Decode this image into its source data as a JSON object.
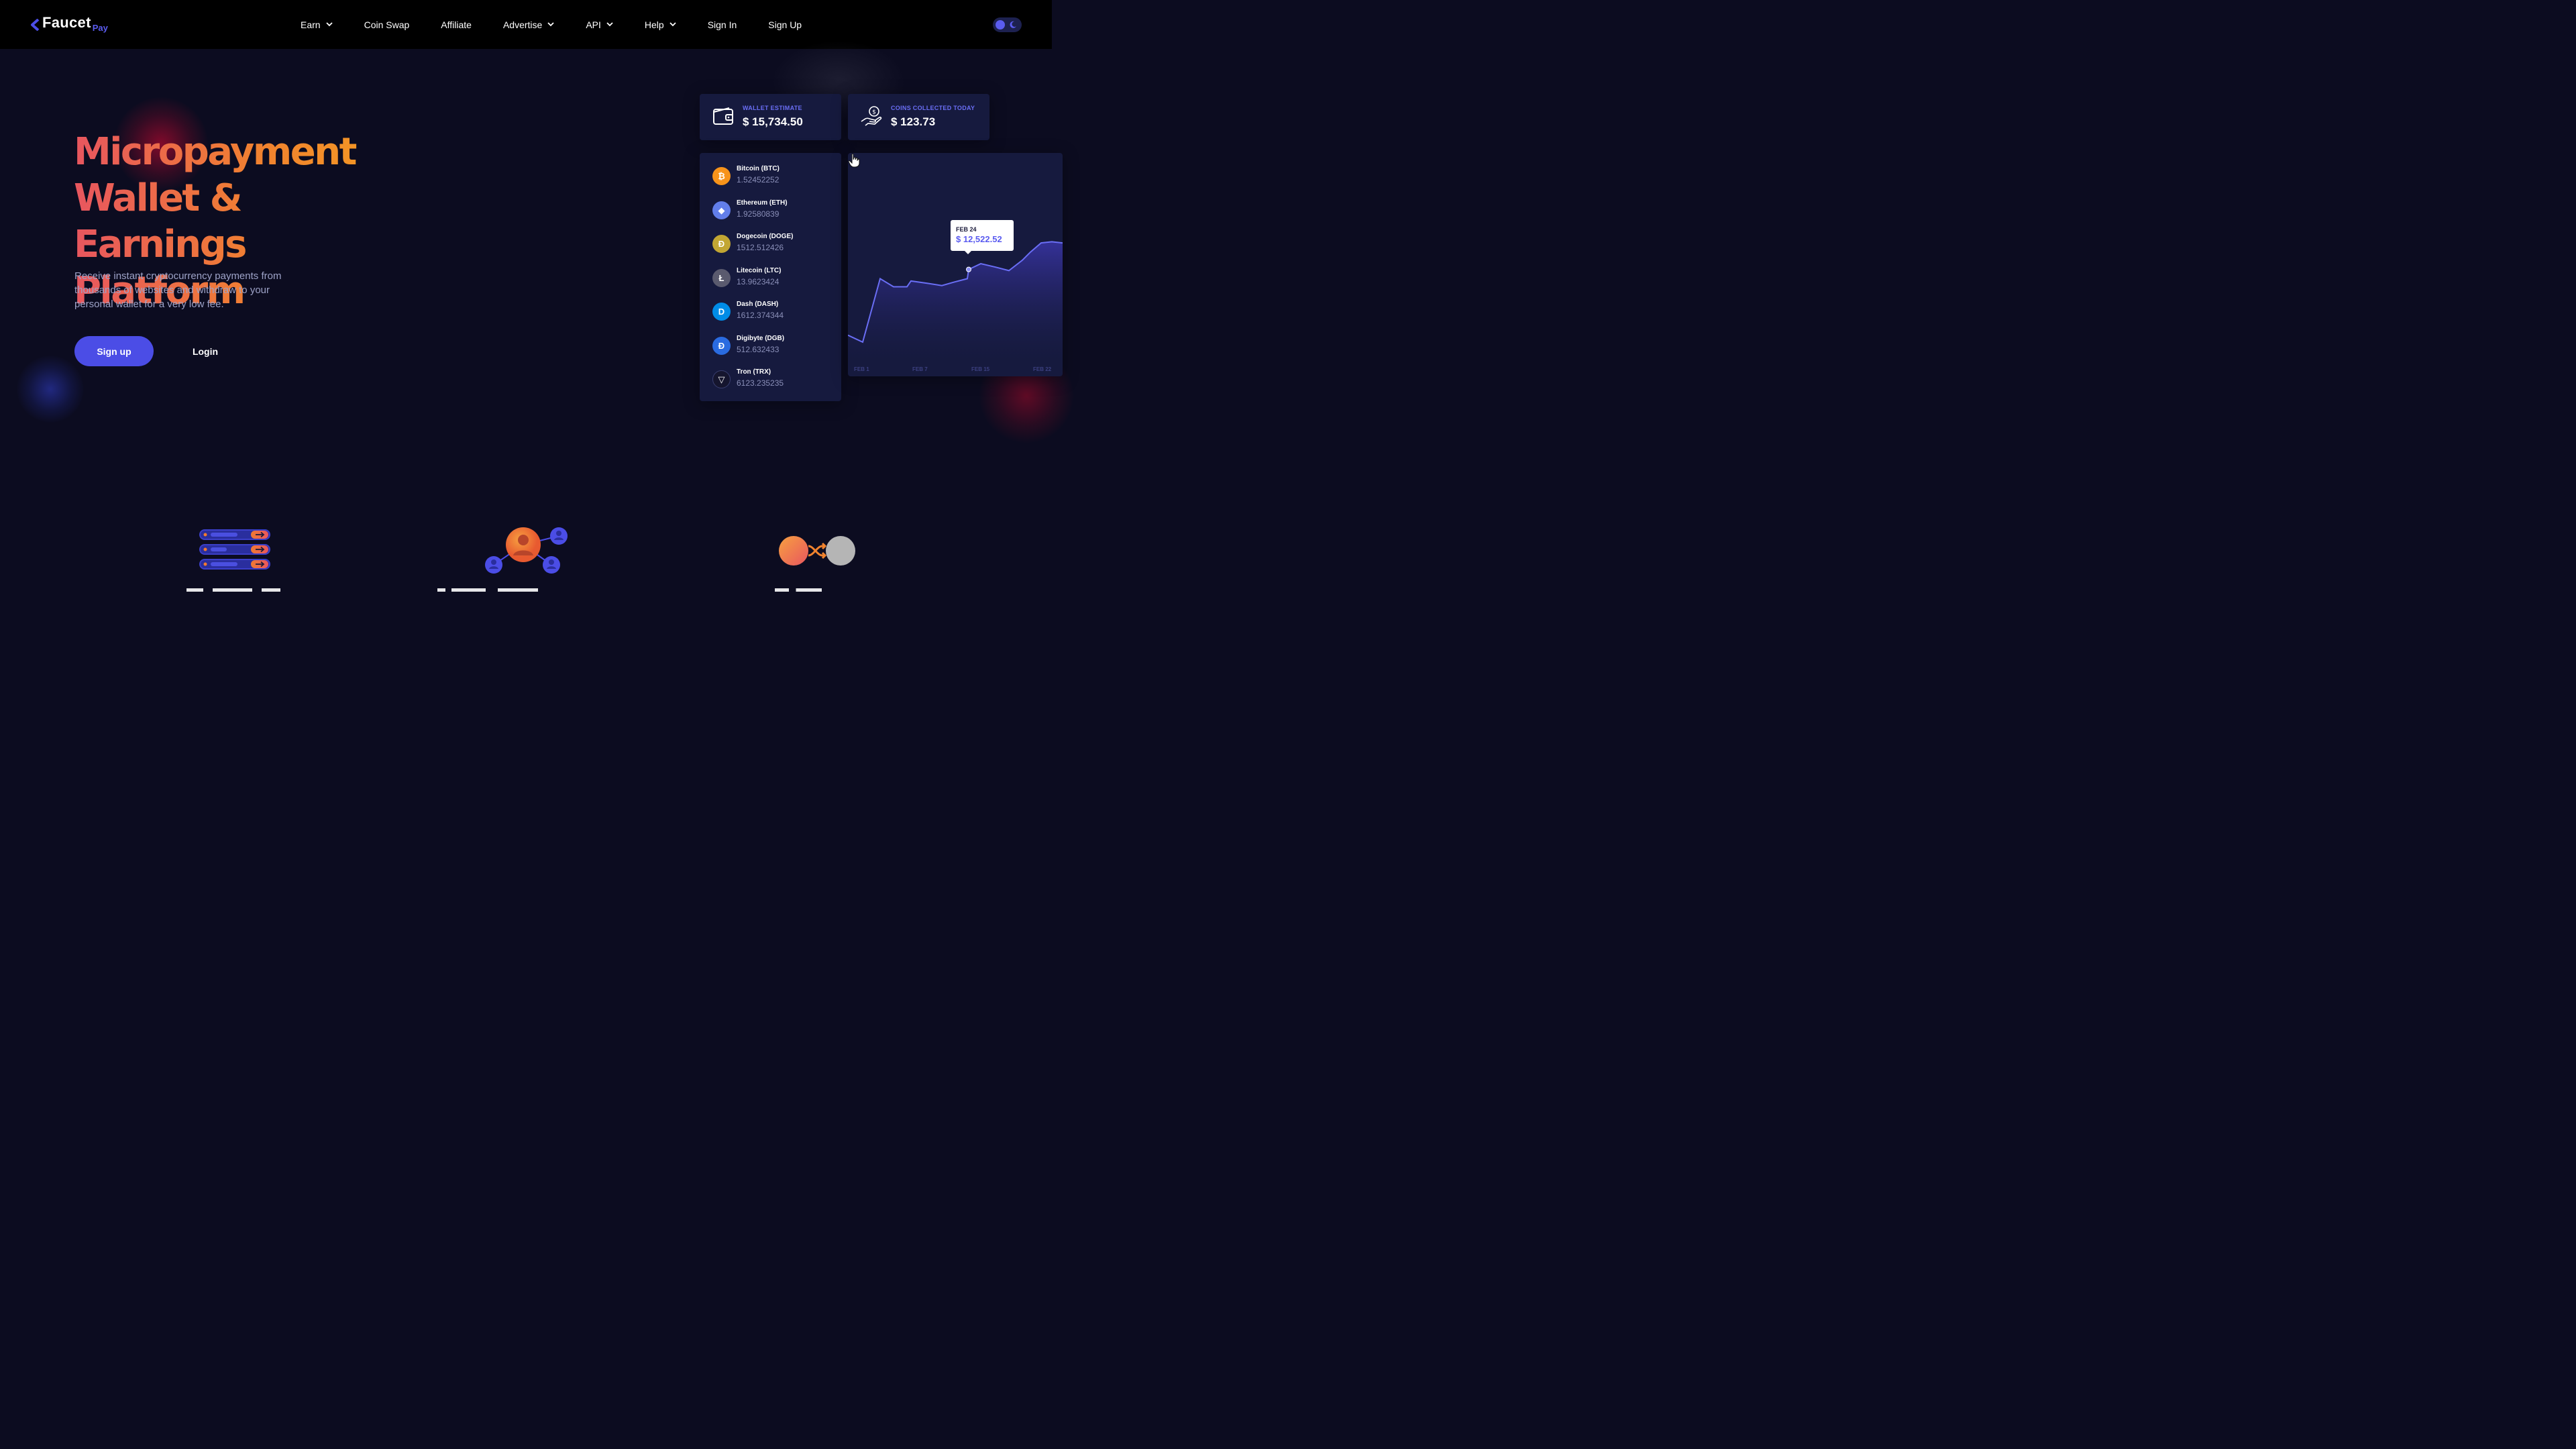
{
  "nav": {
    "logo_text": "Faucet",
    "logo_sub": "Pay",
    "items": [
      {
        "label": "Earn",
        "dropdown": true
      },
      {
        "label": "Coin Swap",
        "dropdown": false
      },
      {
        "label": "Affiliate",
        "dropdown": false
      },
      {
        "label": "Advertise",
        "dropdown": true
      },
      {
        "label": "API",
        "dropdown": true
      },
      {
        "label": "Help",
        "dropdown": true
      },
      {
        "label": "Sign In",
        "dropdown": false
      },
      {
        "label": "Sign Up",
        "dropdown": false
      }
    ],
    "theme_toggle": "dark-mode-toggle"
  },
  "hero": {
    "title_line1": "Micropayment",
    "title_line2": "Wallet & Earnings",
    "title_line3": "Platform",
    "subtitle": "Receive instant cryptocurrency payments from thousands of websites and withdraw to your personal wallet for a very low fee.",
    "signup_label": "Sign up",
    "login_label": "Login"
  },
  "dashboard": {
    "wallet": {
      "label": "WALLET ESTIMATE",
      "value": "$ 15,734.50",
      "icon": "wallet-icon"
    },
    "coins_today": {
      "label": "COINS COLLECTED TODAY",
      "value": "$ 123.73",
      "icon": "hand-coin-icon"
    },
    "coins": [
      {
        "name": "Bitcoin (BTC)",
        "amount": "1.52452252",
        "color": "#f7931a",
        "symbol": "₿"
      },
      {
        "name": "Ethereum (ETH)",
        "amount": "1.92580839",
        "color": "#627eea",
        "symbol": "◆"
      },
      {
        "name": "Dogecoin (DOGE)",
        "amount": "1512.512426",
        "color": "#c2a633",
        "symbol": "Ð"
      },
      {
        "name": "Litecoin (LTC)",
        "amount": "13.9623424",
        "color": "#5a5a6e",
        "symbol": "Ł"
      },
      {
        "name": "Dash (DASH)",
        "amount": "1612.374344",
        "color": "#008ce7",
        "symbol": "D"
      },
      {
        "name": "Digibyte (DGB)",
        "amount": "512.632433",
        "color": "#2a6be0",
        "symbol": "Ɖ"
      },
      {
        "name": "Tron (TRX)",
        "amount": "6123.235235",
        "color": "#15152e",
        "symbol": "▽"
      }
    ],
    "tooltip": {
      "date": "FEB 24",
      "value": "$ 12,522.52"
    },
    "x_ticks": [
      "FEB 1",
      "FEB 7",
      "FEB 15",
      "FEB 22"
    ],
    "colors": {
      "line": "#6a6ef5",
      "fill_top": "#3a35a8",
      "fill_bottom": "#161a3e",
      "accent": "#4b4de6"
    }
  },
  "chart_data": {
    "type": "area",
    "title": "",
    "xlabel": "",
    "ylabel": "",
    "x": [
      "FEB 1",
      "",
      "",
      "",
      "",
      "",
      "",
      "FEB 7",
      "",
      "",
      "",
      "",
      "",
      "",
      "FEB 15",
      "",
      "",
      "",
      "",
      "",
      "",
      "FEB 22",
      ""
    ],
    "values": [
      0.06,
      0.0,
      0.55,
      0.48,
      0.48,
      0.53,
      0.51,
      0.49,
      0.52,
      0.55,
      0.63,
      0.68,
      0.65,
      0.62,
      0.71,
      0.78,
      0.86,
      0.87,
      0.86
    ],
    "highlight": {
      "label": "FEB 24",
      "value": "$ 12,522.52"
    },
    "grid": false,
    "legend": "none"
  },
  "features": [
    {
      "icon": "server-stack-icon"
    },
    {
      "icon": "user-network-icon"
    },
    {
      "icon": "coin-swap-icon"
    }
  ]
}
